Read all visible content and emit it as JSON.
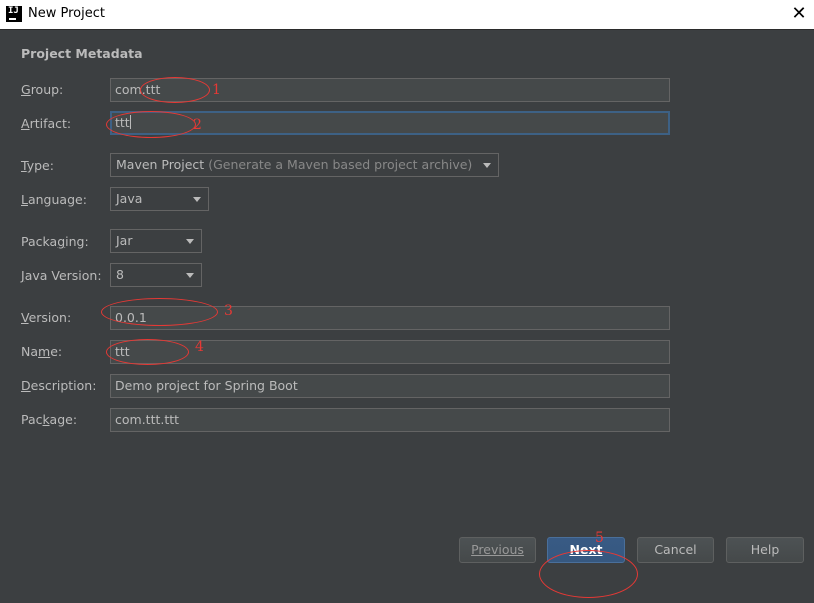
{
  "window": {
    "title": "New Project",
    "app_icon_text": "IJ"
  },
  "section": {
    "title": "Project Metadata"
  },
  "fields": {
    "group": {
      "label": "Group:",
      "value": "com.ttt"
    },
    "artifact": {
      "label": "Artifact:",
      "value": "ttt"
    },
    "type": {
      "label": "Type:",
      "value": "Maven Project",
      "hint": "(Generate a Maven based project archive)"
    },
    "language": {
      "label": "Language:",
      "value": "Java"
    },
    "packaging": {
      "label": "Packaging:",
      "value": "Jar"
    },
    "java_version": {
      "label": "Java Version:",
      "value": "8"
    },
    "version": {
      "label": "Version:",
      "value": "0.0.1"
    },
    "name": {
      "label": "Name:",
      "value": "ttt"
    },
    "description": {
      "label": "Description:",
      "value": "Demo project for Spring Boot"
    },
    "package": {
      "label": "Package:",
      "value": "com.ttt.ttt"
    }
  },
  "buttons": {
    "previous": "Previous",
    "next": "Next",
    "cancel": "Cancel",
    "help": "Help"
  },
  "annotations": [
    "1",
    "2",
    "3",
    "4",
    "5"
  ],
  "colors": {
    "background": "#3c3f41",
    "field_bg": "#45494a",
    "primary": "#365880",
    "annotation": "#e53935"
  }
}
